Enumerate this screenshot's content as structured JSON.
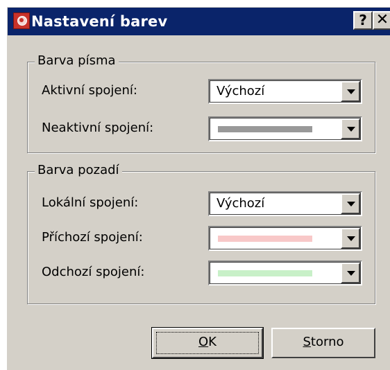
{
  "window": {
    "title": "Nastavení barev",
    "help_glyph": "?",
    "close_glyph": "✕"
  },
  "font_color_group": {
    "legend": "Barva písma",
    "rows": [
      {
        "label": "Aktivní spojení:",
        "value": "Výchozí",
        "swatch": null
      },
      {
        "label": "Neaktivní spojení:",
        "value": "",
        "swatch": "#999999"
      }
    ]
  },
  "background_color_group": {
    "legend": "Barva pozadí",
    "rows": [
      {
        "label": "Lokální spojení:",
        "value": "Výchozí",
        "swatch": null
      },
      {
        "label": "Příchozí spojení:",
        "value": "",
        "swatch": "#f8c8c8"
      },
      {
        "label": "Odchozí spojení:",
        "value": "",
        "swatch": "#c8f0c8"
      }
    ]
  },
  "buttons": {
    "ok_mnemonic": "O",
    "ok_rest": "K",
    "cancel_mnemonic": "S",
    "cancel_rest": "torno"
  },
  "colors": {
    "titlebar": "#0a246a",
    "dialog_face": "#d4d0c8",
    "inactive_swatch": "#999999",
    "incoming_swatch": "#f8c8c8",
    "outgoing_swatch": "#c8f0c8"
  }
}
